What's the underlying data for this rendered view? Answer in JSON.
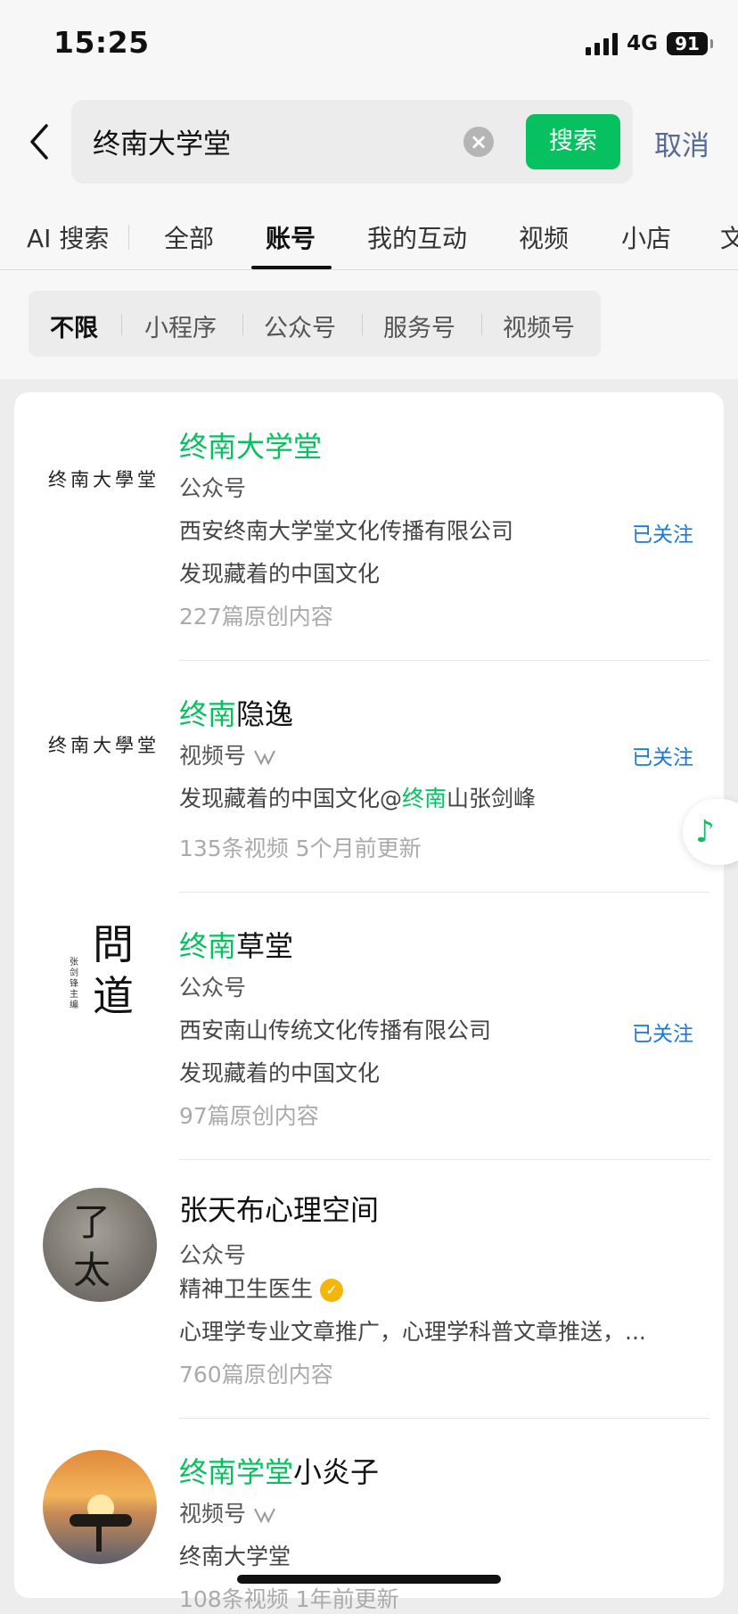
{
  "status": {
    "time": "15:25",
    "network": "4G",
    "battery": "91"
  },
  "search": {
    "query": "终南大学堂",
    "button": "搜索",
    "cancel": "取消"
  },
  "tabs": [
    "AI 搜索",
    "全部",
    "账号",
    "我的互动",
    "视频",
    "小店",
    "文"
  ],
  "active_tab": "账号",
  "filters": [
    "不限",
    "小程序",
    "公众号",
    "服务号",
    "视频号"
  ],
  "active_filter": "不限",
  "results": [
    {
      "logo_text": "终南大學堂",
      "title_hl": "终南大学堂",
      "title_rest": "",
      "type": "公众号",
      "line1": "西安终南大学堂文化传播有限公司",
      "line2": "发现藏着的中国文化",
      "stats": "227篇原创内容",
      "follow": "已关注"
    },
    {
      "logo_text": "终南大學堂",
      "title_hl": "终南",
      "title_rest": "隐逸",
      "type": "视频号",
      "line1_pre": "发现藏着的中国文化@",
      "line1_hl": "终南",
      "line1_post": "山张剑峰",
      "stats": "135条视频   5个月前更新",
      "follow": "已关注"
    },
    {
      "logo_big": "問道",
      "logo_small": "张剑锋 主编",
      "title_hl": "终南",
      "title_rest": "草堂",
      "type": "公众号",
      "line1": "西安南山传统文化传播有限公司",
      "line2": "发现藏着的中国文化",
      "stats": "97篇原创内容",
      "follow": "已关注"
    },
    {
      "avatar_text": "了太",
      "title": "张天布心理空间",
      "type": "公众号",
      "verify": "精神卫生医生",
      "line2": "心理学专业文章推广，心理学科普文章推送，...",
      "stats": "760篇原创内容"
    },
    {
      "title_hl": "终南学堂",
      "title_rest": "小炎子",
      "type": "视频号",
      "line1_hl": "终南大学堂",
      "stats": "108条视频   1年前更新"
    }
  ],
  "colors": {
    "accent": "#07c160",
    "link": "#1479e0",
    "cancel": "#576b95"
  }
}
